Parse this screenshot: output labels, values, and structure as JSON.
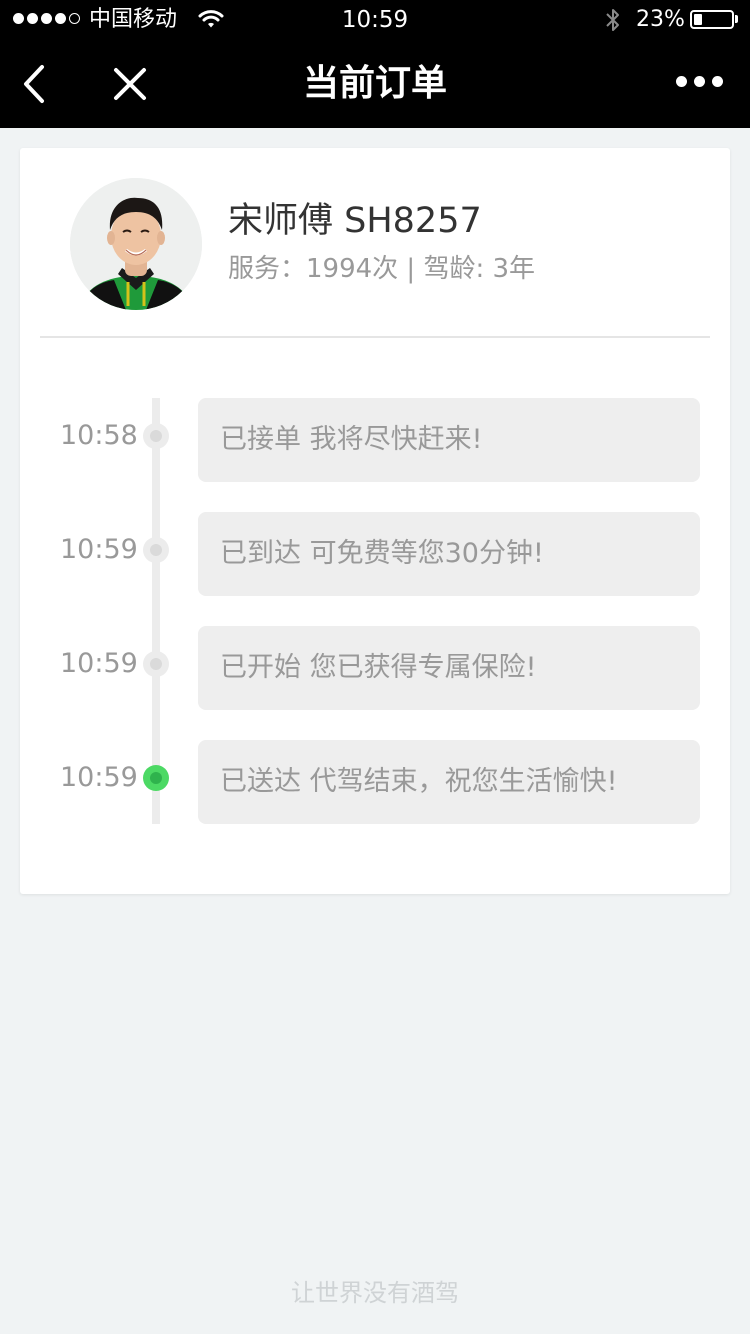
{
  "status_bar": {
    "carrier": "中国移动",
    "time": "10:59",
    "battery_percent": "23%",
    "battery_level": 0.23,
    "signal_bars": 4,
    "signal_total": 5
  },
  "nav": {
    "title": "当前订单",
    "back_icon": "chevron-left-icon",
    "close_icon": "close-icon",
    "more_icon": "more-dots-icon"
  },
  "driver": {
    "name": "宋师傅 SH8257",
    "stats": "服务：1994次 | 驾龄: 3年"
  },
  "timeline": [
    {
      "time": "10:58",
      "message": "已接单 我将尽快赶来!",
      "active": false
    },
    {
      "time": "10:59",
      "message": "已到达 可免费等您30分钟!",
      "active": false
    },
    {
      "time": "10:59",
      "message": "已开始 您已获得专属保险!",
      "active": false
    },
    {
      "time": "10:59",
      "message": "已送达 代驾结束，祝您生活愉快!",
      "active": true
    }
  ],
  "footer": {
    "slogan": "让世界没有酒驾"
  },
  "colors": {
    "nav_background": "#000000",
    "page_background": "#f0f3f4",
    "active_node": "#4cd964",
    "bubble_background": "#eeeeee"
  }
}
